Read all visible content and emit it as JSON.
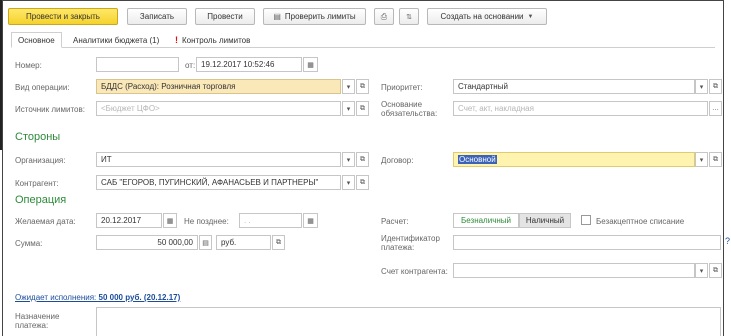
{
  "toolbar": {
    "post_close": "Провести и закрыть",
    "save": "Записать",
    "post": "Провести",
    "check_limits": "Проверить лимиты",
    "create_based": "Создать на основании"
  },
  "tabs": [
    {
      "label": "Основное"
    },
    {
      "label": "Аналитики бюджета (1)"
    },
    {
      "label": "Контроль лимитов"
    }
  ],
  "form": {
    "number_label": "Номер:",
    "number_value": "",
    "from_label": "от:",
    "date_value": "19.12.2017 10:52:46",
    "operation_label": "Вид операции:",
    "operation_value": "БДДС (Расход): Розничная торговля",
    "source_label": "Источник лимитов:",
    "source_placeholder": "<Бюджет ЦФО>",
    "priority_label": "Приоритет:",
    "priority_value": "Стандартный",
    "basis_label": "Основание обязательства:",
    "basis_placeholder": "Счет, акт, накладная"
  },
  "parties": {
    "section_title": "Стороны",
    "org_label": "Организация:",
    "org_value": "ИТ",
    "contractor_label": "Контрагент:",
    "contractor_value": "САБ \"ЕГОРОВ, ПУГИНСКИЙ, АФАНАСЬЕВ И ПАРТНЕРЫ\"",
    "contract_label": "Договор:",
    "contract_value": "Основной"
  },
  "operation": {
    "section_title": "Операция",
    "desired_date_label": "Желаемая дата:",
    "desired_date_value": "20.12.2017",
    "not_later_label": "Не позднее:",
    "not_later_value": ". .",
    "sum_label": "Сумма:",
    "sum_value": "50 000,00",
    "currency_value": "руб.",
    "calc_label": "Расчет:",
    "cashless": "Безналичный",
    "cash": "Наличный",
    "no_accept_label": "Безакцептное списание",
    "payment_id_label": "Идентификатор платежа:",
    "account_label": "Счет контрагента:"
  },
  "footer": {
    "awaiting_prefix": "Ожидает исполнения: ",
    "awaiting_value": "50 000 руб. (20.12.17)",
    "purpose_label": "Назначение платежа:"
  },
  "colors": {
    "primary_button": "#f5d22c",
    "section": "#2e8b3a",
    "link": "#1c4c9a",
    "required_field": "#fbe8b9"
  }
}
